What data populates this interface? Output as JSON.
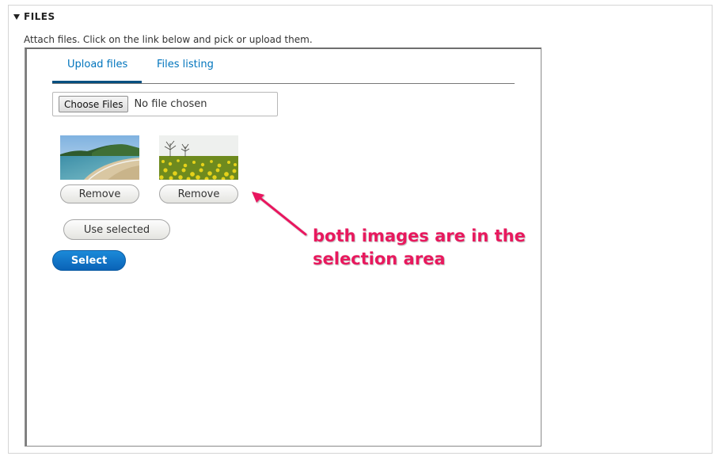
{
  "fieldset": {
    "legend": "FILES",
    "description": "Attach files. Click on the link below and pick or upload them."
  },
  "tabs": [
    {
      "label": "Upload files",
      "active": true
    },
    {
      "label": "Files listing",
      "active": false
    }
  ],
  "file_input": {
    "button_label": "Choose Files",
    "status": "No file chosen"
  },
  "selected_images": [
    {
      "name": "beach",
      "remove_label": "Remove"
    },
    {
      "name": "rapeseed-field",
      "remove_label": "Remove"
    }
  ],
  "use_selected_label": "Use selected",
  "select_label": "Select",
  "annotation": {
    "text": "both images are in the selection area"
  },
  "colors": {
    "link": "#0074bd",
    "primary_button": "#0a63b7",
    "annotation": "#e8195e"
  }
}
